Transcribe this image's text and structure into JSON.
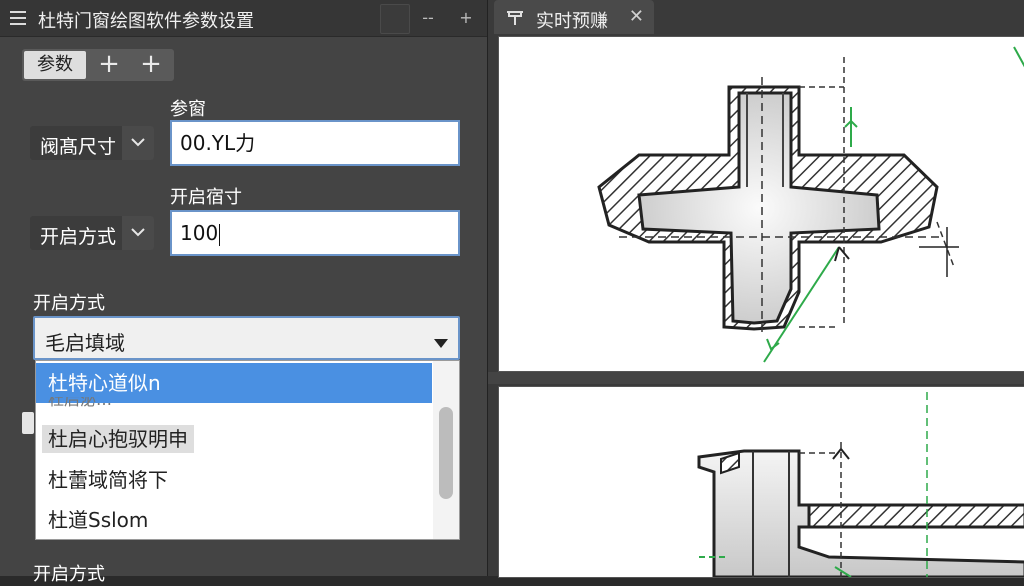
{
  "left_panel": {
    "title": "杜特门窗绘图软件参数设置",
    "title_buttons": {
      "minimize": "--",
      "add": "+"
    },
    "tabs": {
      "params": "参数",
      "add1": "+",
      "add2": "+"
    },
    "field1": {
      "top_label": "参窗",
      "select_label": "阀髙尺寸",
      "input_value": "00.YL力"
    },
    "field2": {
      "top_label": "开启宿寸",
      "select_label": "开启方式",
      "input_value": "100"
    },
    "dropdown": {
      "label": "开启方式",
      "value": "毛启填域",
      "options": [
        "杜特心道似n",
        "杜启心抱驭明申",
        "杜蕾域简将下",
        "杜道Sslom"
      ],
      "ghost_text": "杜后泌…"
    },
    "bottom_label": "开启方式"
  },
  "right_panel": {
    "tab_title": "实时预赚",
    "tab_close": "✕"
  },
  "colors": {
    "panel_bg": "#444444",
    "title_bg": "#363636",
    "accent": "#4a90e2",
    "input_border": "#6a94c9",
    "dimension_green": "#2eaa4a"
  }
}
